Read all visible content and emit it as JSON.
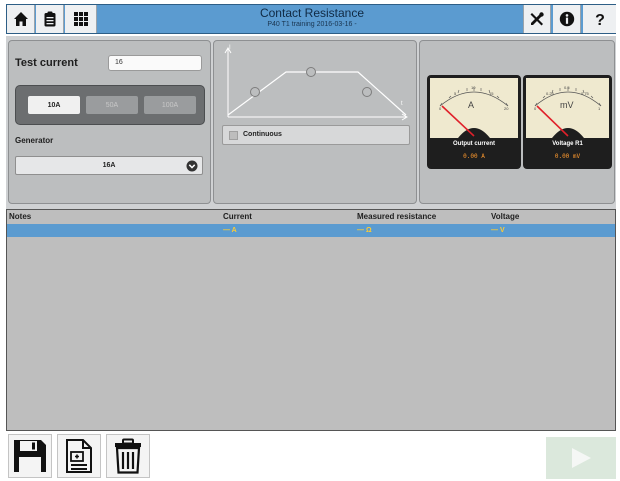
{
  "header": {
    "title": "Contact Resistance",
    "subtitle": "P40 T1 training 2016-03-16 -"
  },
  "left_panel": {
    "test_current_label": "Test current",
    "test_current_value": "16",
    "range_buttons": [
      "10A",
      "50A",
      "100A"
    ],
    "selected_range": "10A",
    "generator_label": "Generator",
    "generator_value": "16A"
  },
  "ramp_panel": {
    "axis_y": "I",
    "axis_x": "t",
    "continuous_label": "Continuous",
    "continuous_checked": false
  },
  "meters": [
    {
      "unit": "A",
      "scale": [
        "0",
        "5",
        "10",
        "15",
        "20"
      ],
      "label": "Output current",
      "value": "0.00 A",
      "reading": 0
    },
    {
      "unit": "mV",
      "scale": [
        "0",
        "0.25",
        "0.5",
        "0.75",
        "1"
      ],
      "label": "Voltage R1",
      "value": "0.00 mV",
      "reading": 0
    }
  ],
  "table": {
    "columns": [
      "Notes",
      "Current",
      "Measured resistance",
      "Voltage"
    ],
    "rows": [
      {
        "notes": "",
        "current": "— A",
        "resistance": "— Ω",
        "voltage": "— V"
      }
    ]
  },
  "colors": {
    "header_blue": "#5b9bd0",
    "value_orange": "#ffcc33",
    "needle_red": "#e0202a"
  },
  "icons": [
    "home-icon",
    "clipboard-icon",
    "grid-icon",
    "tools-icon",
    "info-icon",
    "help-icon",
    "save-icon",
    "new-document-icon",
    "trash-icon",
    "play-icon"
  ]
}
